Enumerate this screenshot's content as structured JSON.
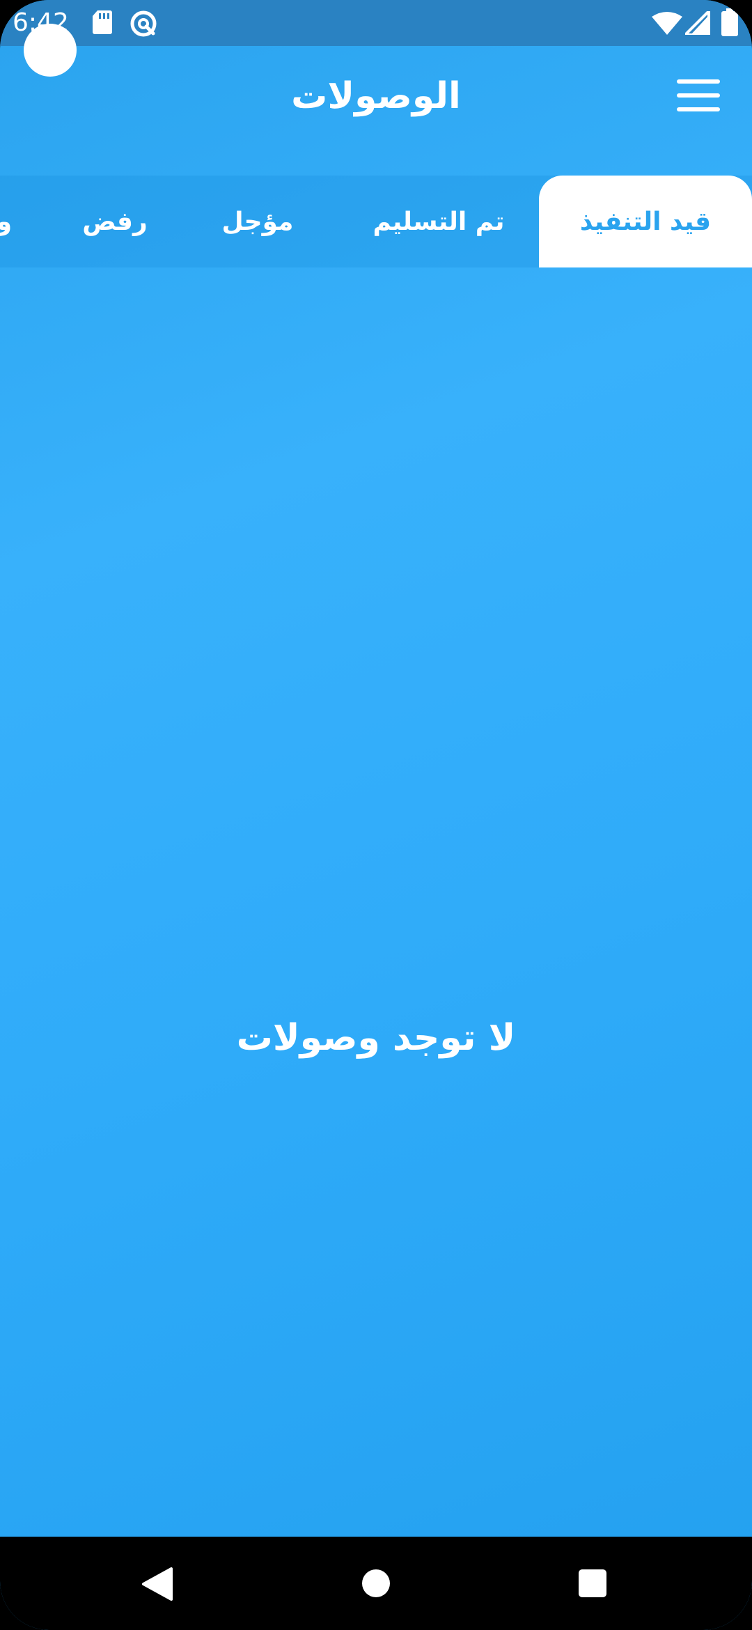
{
  "status_bar": {
    "time": "6:42",
    "icons": [
      "sd-card-icon",
      "vpn-status-icon",
      "wifi-icon",
      "cell-signal-icon",
      "battery-icon"
    ]
  },
  "app_bar": {
    "title": "الوصولات",
    "menu_icon": "menu-icon"
  },
  "tabs": [
    {
      "label": "قيد التنفيذ",
      "active": true
    },
    {
      "label": "تم التسليم",
      "active": false
    },
    {
      "label": "مؤجل",
      "active": false
    },
    {
      "label": "رفض",
      "active": false
    },
    {
      "label": "و",
      "active": false
    }
  ],
  "empty_state": {
    "message": "لا توجد وصولات"
  },
  "nav_bar": {
    "buttons": [
      "back-icon",
      "home-icon",
      "recents-icon"
    ]
  },
  "colors": {
    "primary": "#2fabf9",
    "status_bar": "#2a82c2",
    "active_tab_bg": "#ffffff",
    "active_tab_text": "#2aa3ee"
  }
}
